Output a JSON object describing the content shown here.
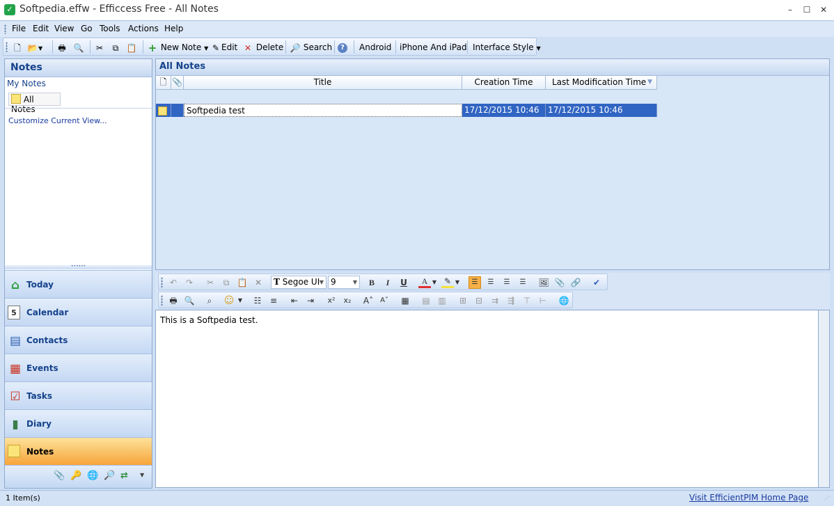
{
  "window": {
    "title": "Softpedia.effw - Efficcess Free - All Notes",
    "app_icon": "check-icon",
    "controls": {
      "minimize": "–",
      "maximize": "☐",
      "close": "✕"
    }
  },
  "menu": {
    "items": [
      "File",
      "Edit",
      "View",
      "Go",
      "Tools",
      "Actions",
      "Help"
    ]
  },
  "toolbar": {
    "new_note": "New Note",
    "edit": "Edit",
    "delete": "Delete",
    "search": "Search",
    "android": "Android",
    "iphone": "iPhone And iPad",
    "interface_style": "Interface Style"
  },
  "sidebar": {
    "title": "Notes",
    "group": "My Notes",
    "selected_view": "All Notes",
    "customize_link": "Customize Current View...",
    "nav": [
      {
        "label": "Today",
        "icon": "home-icon"
      },
      {
        "label": "Calendar",
        "icon": "calendar-icon"
      },
      {
        "label": "Contacts",
        "icon": "contacts-icon"
      },
      {
        "label": "Events",
        "icon": "events-icon"
      },
      {
        "label": "Tasks",
        "icon": "tasks-icon"
      },
      {
        "label": "Diary",
        "icon": "diary-icon"
      },
      {
        "label": "Notes",
        "icon": "note-icon"
      }
    ],
    "active": "Notes"
  },
  "main": {
    "title": "All Notes",
    "columns": {
      "title": "Title",
      "creation": "Creation Time",
      "modified": "Last Modification Time"
    },
    "rows": [
      {
        "title": "Softpedia test",
        "creation": "17/12/2015 10:46",
        "modified": "17/12/2015 10:46"
      }
    ]
  },
  "editor": {
    "font": "Segoe UI",
    "size": "9",
    "content": "This is a Softpedia test."
  },
  "status": {
    "count": "1 Item(s)",
    "link": "Visit EfficientPIM Home Page"
  },
  "colors": {
    "accent": "#15428b",
    "selection": "#3165c3",
    "active_nav": "#f7a43a"
  }
}
